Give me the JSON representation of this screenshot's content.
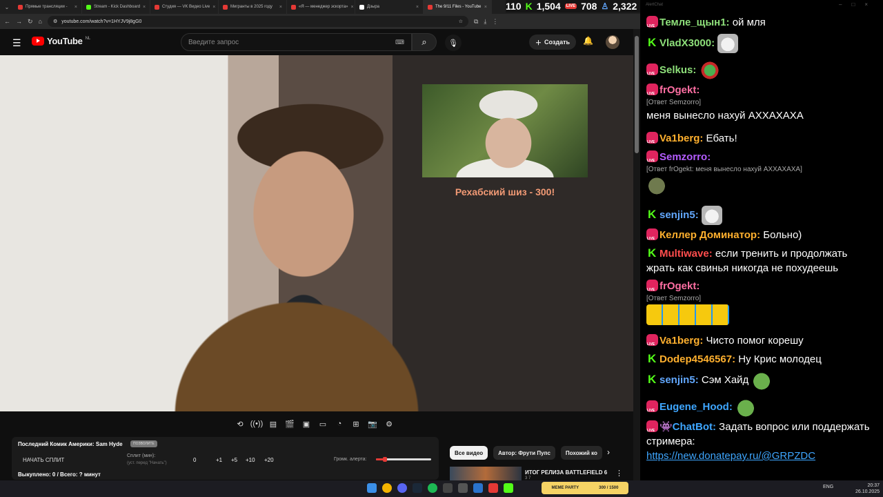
{
  "browser": {
    "tabs": [
      {
        "title": "Прямые трансляции -",
        "color": "#e53935"
      },
      {
        "title": "Stream - Kick Dashboard",
        "color": "#53fc18"
      },
      {
        "title": "Студия — VK Видео Live",
        "color": "#e53935"
      },
      {
        "title": "Мигранты в 2025 году",
        "color": "#e53935"
      },
      {
        "title": "«Я — менеджер эскорта»",
        "color": "#e53935"
      },
      {
        "title": "Дзырa",
        "color": "#ffffff"
      },
      {
        "title": "The 9/11 Files - YouTube",
        "color": "#e53935"
      }
    ],
    "url": "youtube.com/watch?v=1HYJV9j8gG0"
  },
  "stream_stats": {
    "viewers_a": "110",
    "kick_viewers": "1,504",
    "live_viewers": "708",
    "followers": "2,322"
  },
  "youtube": {
    "logo_text": "YouTube",
    "region": "NL",
    "search_placeholder": "Введите запрос",
    "create_label": "Создать"
  },
  "video": {
    "inset_caption": "Рехабский шиз - 300!"
  },
  "panel": {
    "title": "Последний Комик Америки: Sam Hyde",
    "badge": "ПОЗВОЛИТЕ",
    "start_split": "НАЧАТЬ СПЛИТ",
    "split_label": "Сплит (мин):",
    "split_sub": "(уст. перед \"Начать\")",
    "split_value": "0",
    "increments": [
      "+1",
      "+5",
      "+10",
      "+20"
    ],
    "volume_label": "Громк. алерта:",
    "volume_level": 0.16,
    "bought": "Выкуплено: 0 / Всего: ? минут"
  },
  "chips": [
    "Все видео",
    "Автор: Фрути Пупс",
    "Похожий ко"
  ],
  "recommendation": {
    "title": "ИТОГ РЕЛИЗА BATTLEFIELD 6",
    "meta": "3 7"
  },
  "chat": {
    "window_title": "AlertChat",
    "messages": [
      {
        "platform": "yt",
        "name": "Темле_щын1",
        "color": "#8ee07a",
        "text": "ой мля"
      },
      {
        "platform": "kick",
        "name": "VladX3000",
        "color": "#8ee07a",
        "text": "",
        "emote": "cat"
      },
      {
        "platform": "yt",
        "name": "Selkus",
        "color": "#8ee07a",
        "text": "",
        "emote": "frog"
      },
      {
        "platform": "yt",
        "name": "frOgekt",
        "color": "#ff6fa3",
        "reply": "[Ответ Semzorro]",
        "text": "меня вынесло нахуй АХХАХАХА"
      },
      {
        "platform": "yt",
        "name": "Va1berg",
        "color": "#ffb02e",
        "text": "Ебать!"
      },
      {
        "platform": "yt",
        "name": "Semzorro",
        "color": "#b45cff",
        "reply": "[Ответ frOgekt: меня вынесло нахуй АХХАХАХА]",
        "text": "",
        "emote": "fish"
      },
      {
        "platform": "kick",
        "name": "senjin5",
        "color": "#62a8ff",
        "text": "",
        "emote": "cat"
      },
      {
        "platform": "yt",
        "name": "Келлер Доминатор",
        "color": "#ffb02e",
        "text": "Больно)"
      },
      {
        "platform": "kick",
        "name": "Multiwave",
        "color": "#ff4d4d",
        "text": "если тренить и продолжать жрать как свинья никогда не похудеешь"
      },
      {
        "platform": "yt",
        "name": "frOgekt",
        "color": "#ff6fa3",
        "reply": "[Ответ Semzorro]",
        "text": "",
        "emote": "laugh"
      },
      {
        "platform": "yt",
        "name": "Va1berg",
        "color": "#ffb02e",
        "text": "Чисто помог корешу"
      },
      {
        "platform": "kick",
        "name": "Dodep4546567",
        "color": "#ffb02e",
        "text": "Ну Крис молодец"
      },
      {
        "platform": "kick",
        "name": "senjin5",
        "color": "#62a8ff",
        "text": "Сэм Хайд",
        "emote": "pepe"
      },
      {
        "platform": "yt",
        "name": "Eugene_Hood",
        "color": "#3ea6ff",
        "text": "",
        "emote": "pepe"
      },
      {
        "platform": "yt",
        "name": "👾ChatBot",
        "color": "#3ea6ff",
        "text": "Задать вопрос или поддержать стримера:",
        "link": "https://new.donatepay.ru/@GRPZDC"
      }
    ]
  },
  "taskbar": {
    "meme_label": "МЕМЕ PARTY",
    "meme_count": "300 / 1500",
    "lang": "ENG",
    "time": "20:37",
    "date": "26.10.2025"
  }
}
